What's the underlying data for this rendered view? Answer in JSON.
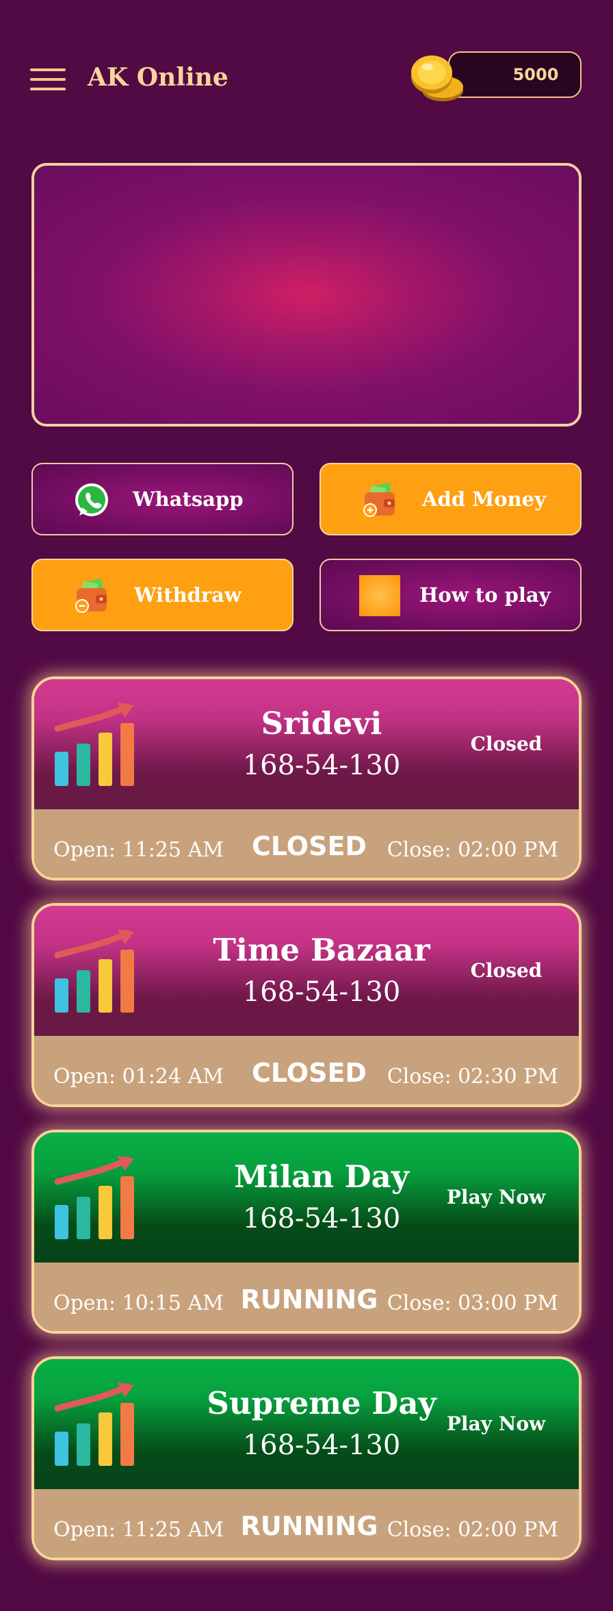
{
  "header": {
    "title": "AK Online",
    "coins": "5000"
  },
  "actions": {
    "whatsapp": "Whatsapp",
    "add_money": "Add Money",
    "withdraw": "Withdraw",
    "how_to_play": "How to play"
  },
  "markets": [
    {
      "name": "Sridevi",
      "numbers": "168-54-130",
      "action": "Closed",
      "open": "Open: 11:25 AM",
      "close": "Close: 02:00 PM",
      "state": "CLOSED"
    },
    {
      "name": "Time Bazaar",
      "numbers": "168-54-130",
      "action": "Closed",
      "open": "Open: 01:24 AM",
      "close": "Close: 02:30 PM",
      "state": "CLOSED"
    },
    {
      "name": "Milan Day",
      "numbers": "168-54-130",
      "action": "Play Now",
      "open": "Open: 10:15 AM",
      "close": "Close: 03:00 PM",
      "state": "RUNNING"
    },
    {
      "name": "Supreme Day",
      "numbers": "168-54-130",
      "action": "Play Now",
      "open": "Open: 11:25 AM",
      "close": "Close: 02:00 PM",
      "state": "RUNNING"
    }
  ],
  "colors": {
    "background": "#520a44",
    "accent": "#f8d49a",
    "orange": "#ff9f12",
    "closed": "#c23285",
    "running": "#07a03e"
  }
}
